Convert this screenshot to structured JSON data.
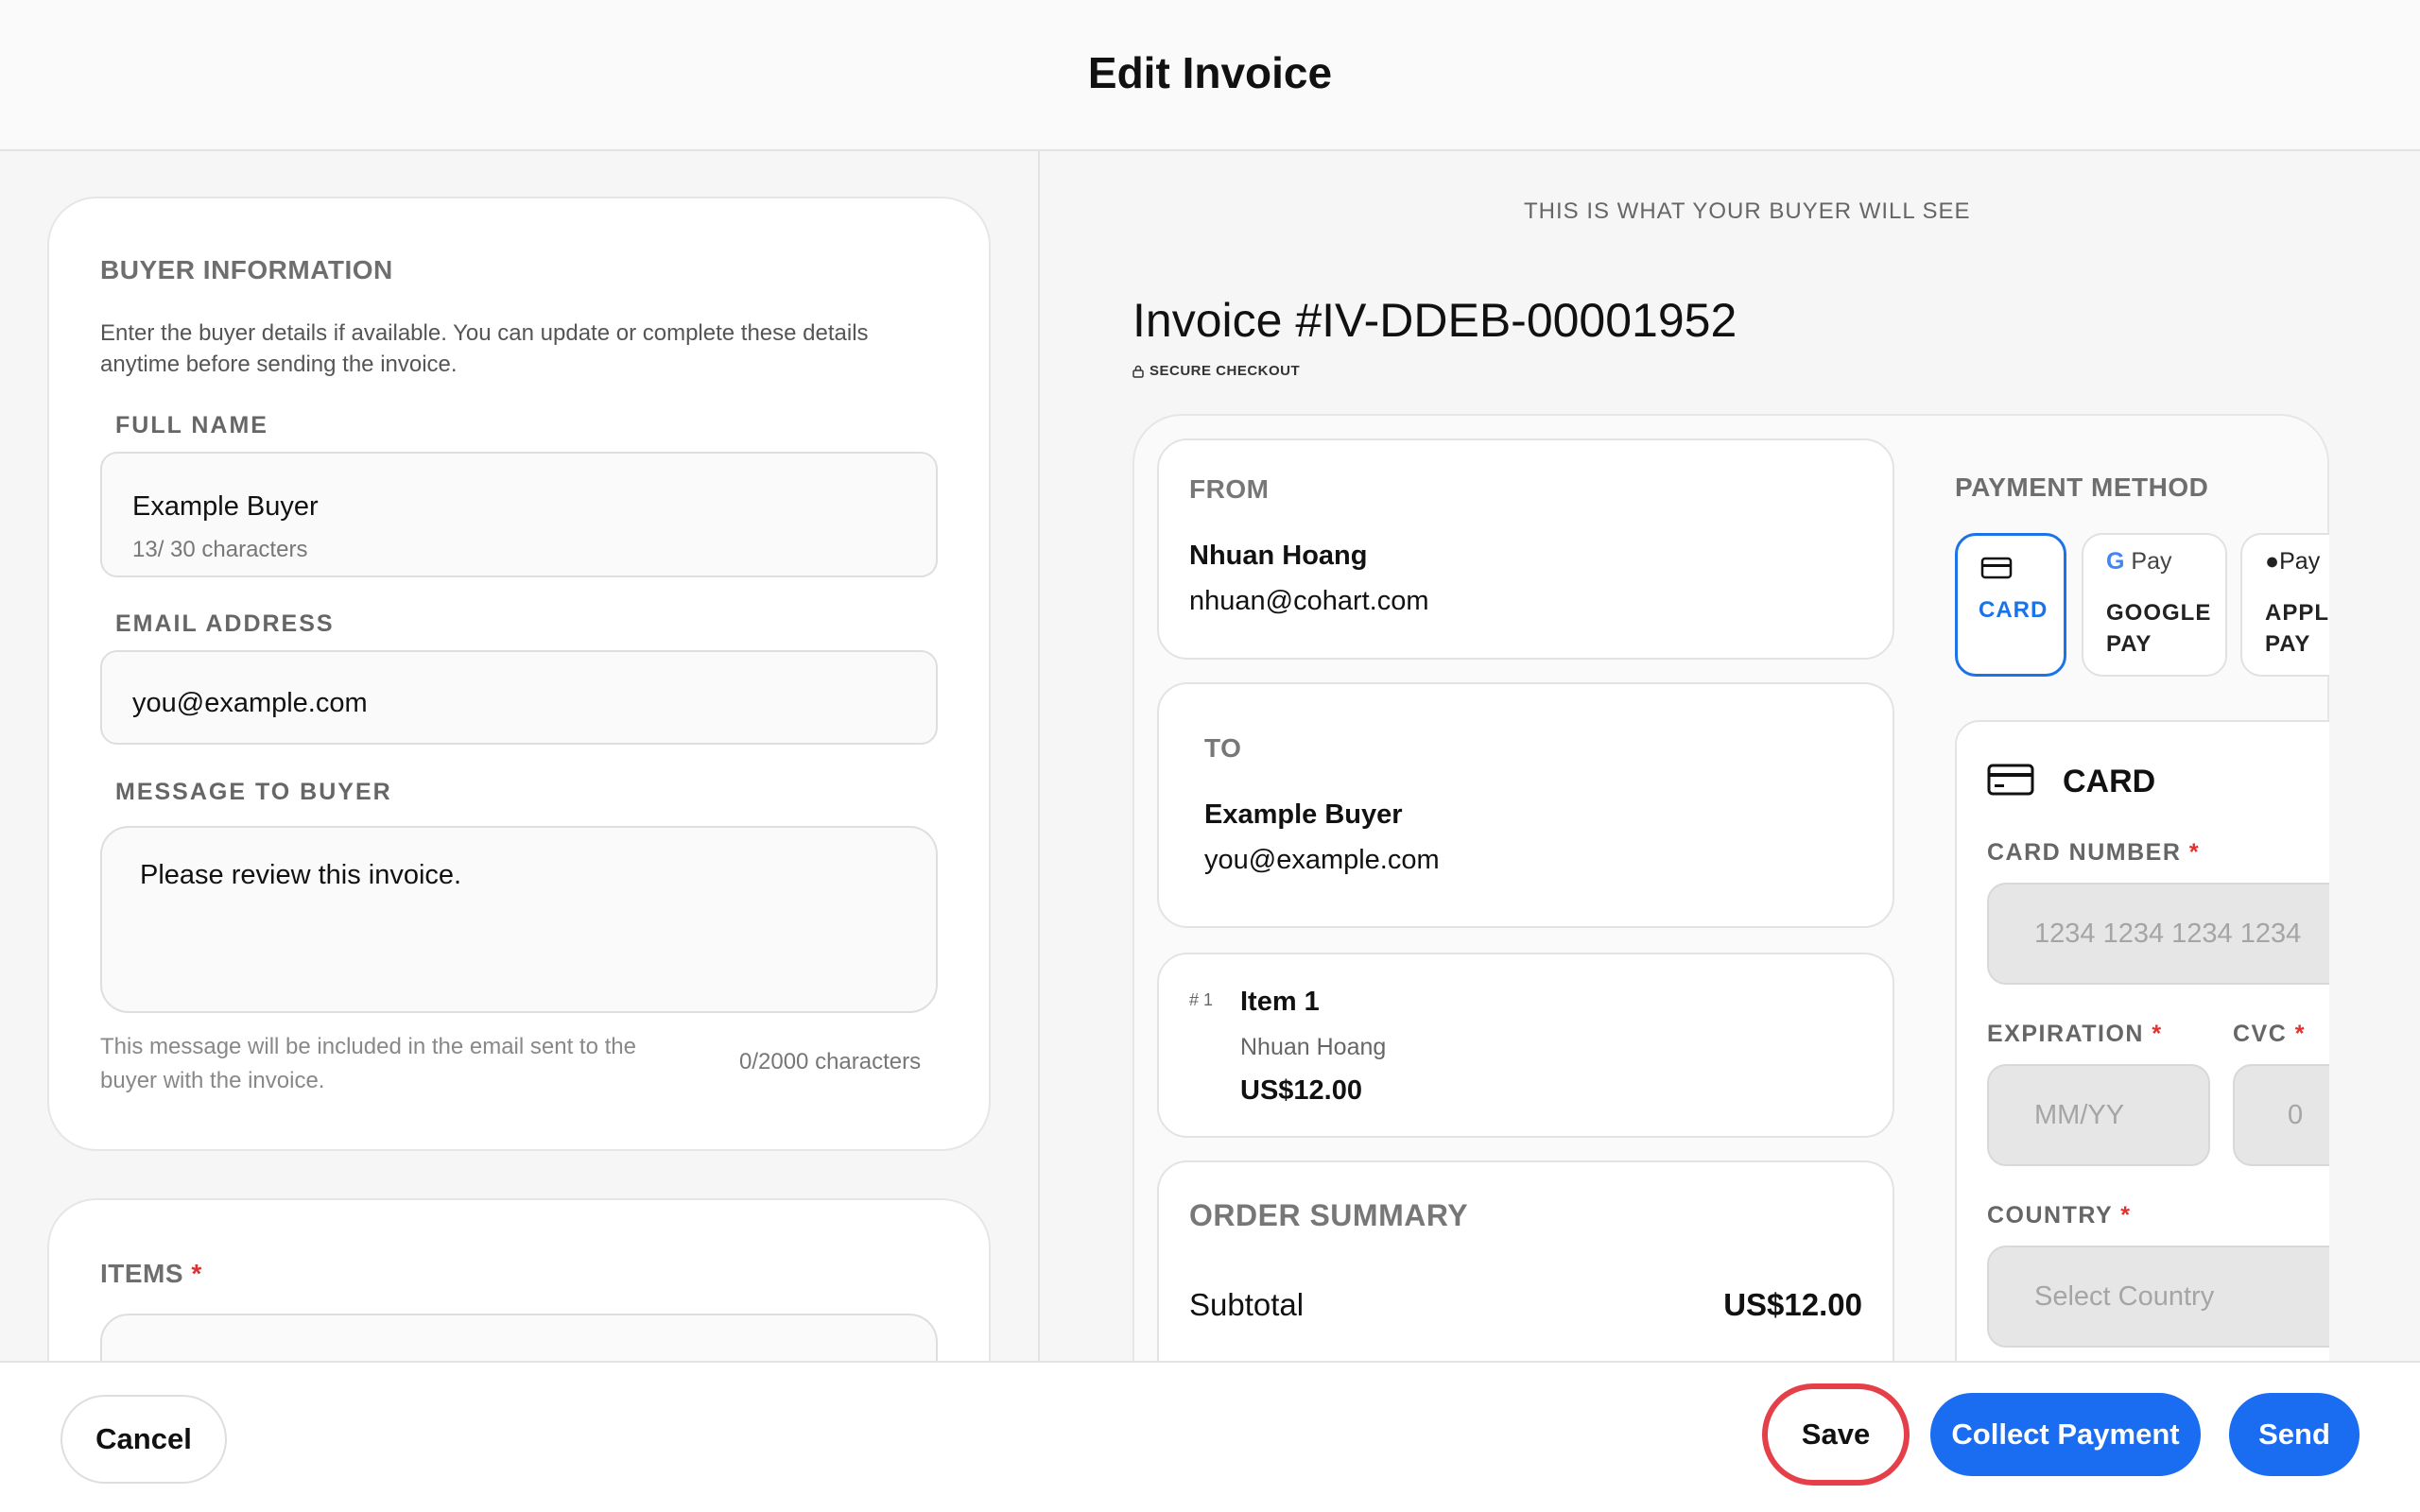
{
  "header": {
    "title": "Edit Invoice"
  },
  "buyer": {
    "section_title": "BUYER INFORMATION",
    "description_line1": "Enter the buyer details if available. You can update or complete these details",
    "description_line2": "anytime before sending the invoice.",
    "full_name_label": "FULL NAME",
    "full_name_value": "Example Buyer",
    "full_name_counter": "13/ 30 characters",
    "email_label": "EMAIL ADDRESS",
    "email_value": "you@example.com",
    "message_label": "MESSAGE TO BUYER",
    "message_value": "Please review this invoice.",
    "message_hint_line1": "This message will be included in the email sent to the",
    "message_hint_line2": "buyer with the invoice.",
    "message_counter": "0/2000 characters"
  },
  "items": {
    "section_title": "ITEMS",
    "required_mark": "*"
  },
  "preview": {
    "caption": "THIS IS WHAT YOUR BUYER WILL SEE",
    "invoice_title": "Invoice #IV-DDEB-00001952",
    "secure_label": "SECURE CHECKOUT",
    "from": {
      "title": "FROM",
      "name": "Nhuan Hoang",
      "email": "nhuan@cohart.com"
    },
    "to": {
      "title": "TO",
      "name": "Example Buyer",
      "email": "you@example.com"
    },
    "item": {
      "index": "# 1",
      "name": "Item 1",
      "seller": "Nhuan Hoang",
      "price": "US$12.00"
    },
    "summary": {
      "title": "ORDER SUMMARY",
      "subtotal_label": "Subtotal",
      "subtotal_value": "US$12.00"
    },
    "payment": {
      "title": "PAYMENT METHOD",
      "methods": [
        {
          "label": "CARD",
          "active": true
        },
        {
          "icon_text": "Pay",
          "label_line1": "GOOGLE",
          "label_line2": "PAY"
        },
        {
          "icon_text": "Pay",
          "label_line1": "APPLE",
          "label_line2": "PAY"
        }
      ],
      "card_title": "CARD",
      "card_number_label": "CARD NUMBER",
      "card_number_placeholder": "1234 1234 1234 1234",
      "expiration_label": "EXPIRATION",
      "expiration_placeholder": "MM/YY",
      "cvc_label": "CVC",
      "cvc_placeholder": "0",
      "country_label": "COUNTRY",
      "country_placeholder": "Select Country",
      "required_mark": "*"
    }
  },
  "footer": {
    "cancel_label": "Cancel",
    "save_label": "Save",
    "collect_label": "Collect Payment",
    "send_label": "Send"
  },
  "colors": {
    "accent": "#1a6cf0",
    "highlight": "#e5404a",
    "required": "#e03131"
  }
}
